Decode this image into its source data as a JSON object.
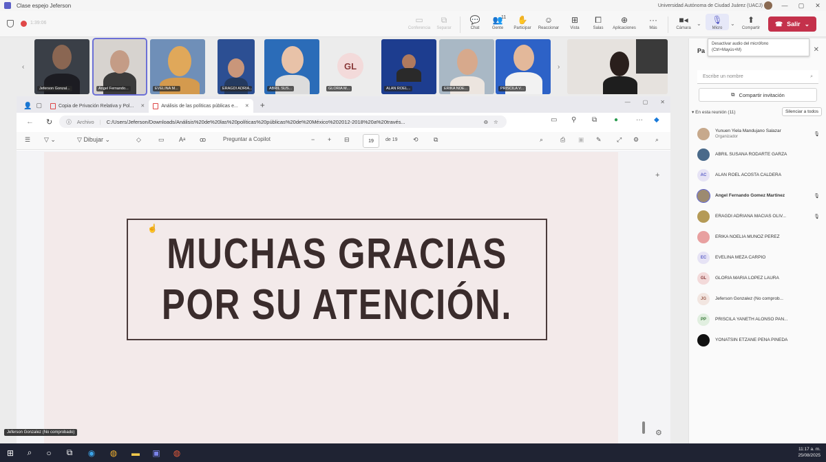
{
  "window": {
    "title": "Clase espejo Jeferson",
    "org": "Universidad Autónoma de Ciudad Juárez (UACJ)"
  },
  "meeting_toolbar": {
    "timer": "1:39:06",
    "buttons": [
      {
        "label": "Conferencia",
        "icon": "conference-icon"
      },
      {
        "label": "Separar",
        "icon": "pop-out-icon"
      },
      {
        "label": "Chat",
        "icon": "chat-icon"
      },
      {
        "label": "Gente",
        "icon": "people-icon",
        "count": "11"
      },
      {
        "label": "Participar",
        "icon": "raise-hand-icon"
      },
      {
        "label": "Reaccionar",
        "icon": "react-icon"
      },
      {
        "label": "Vista",
        "icon": "view-icon"
      },
      {
        "label": "Salas",
        "icon": "rooms-icon"
      },
      {
        "label": "Aplicaciones",
        "icon": "apps-icon"
      },
      {
        "label": "Más",
        "icon": "more-icon"
      },
      {
        "label": "Cámara",
        "icon": "camera-icon"
      },
      {
        "label": "Micro",
        "icon": "mic-icon"
      },
      {
        "label": "Compartir",
        "icon": "share-icon"
      }
    ],
    "leave_label": "Salir",
    "mic_tooltip_line1": "Desactivar audio del micrófono",
    "mic_tooltip_line2": "(Ctrl+Mayús+M)"
  },
  "video_tiles": [
    {
      "name": "Jeferson Gonzal..."
    },
    {
      "name": "Angel Fernando..."
    },
    {
      "name": "EVELINA M..."
    },
    {
      "name": "ERAGDI ADRIA..."
    },
    {
      "name": "ABRIL SUS..."
    },
    {
      "name": "GLORIA M...",
      "initials": "GL"
    },
    {
      "name": "ALAN ROEL..."
    },
    {
      "name": "ERIKA NOE..."
    },
    {
      "name": "PRISCILA V..."
    },
    {
      "name": ""
    }
  ],
  "browser": {
    "tabs": [
      {
        "label": "Copia de Privación Relativa y Pol..."
      },
      {
        "label": "Análisis de las políticas públicas e..."
      }
    ],
    "address_label": "Archivo",
    "url": "C:/Users/Jeferson/Downloads/Análisis%20de%20las%20políticas%20públicas%20de%20México%202012-2018%20a%20través...",
    "pdf_toolbar": {
      "draw_label": "Dibujar",
      "copilot_label": "Preguntar a Copilot",
      "page_current": "19",
      "page_total": "de 19"
    }
  },
  "slide": {
    "line1": "MUCHAS GRACIAS",
    "line2": "POR SU ATENCIÓN."
  },
  "participants_panel": {
    "title": "Pa",
    "search_placeholder": "Escribe un nombre",
    "invite_label": "Compartir invitación",
    "section_label": "▾ En esta reunión (11)",
    "mute_all_label": "Silenciar a todos",
    "participants": [
      {
        "name": "Yunuen Yiela Mandujano Salazar",
        "role": "Organizador",
        "initials": "",
        "avatar_color": "#c7a98c",
        "mic": true
      },
      {
        "name": "ABRIL SUSANA RODARTE GARZA",
        "role": "",
        "initials": "",
        "avatar_color": "#4a6a8a",
        "mic": false
      },
      {
        "name": "ALAN ROEL ACOSTA CALDERA",
        "role": "",
        "initials": "AC",
        "avatar_color": "#e6e3f5",
        "mic": false
      },
      {
        "name": "Angel Fernando Gomez Martinez",
        "role": "",
        "initials": "",
        "avatar_color": "#9c8a70",
        "mic": true
      },
      {
        "name": "ERAGDI ADRIANA MACIAS OLIV...",
        "role": "",
        "initials": "",
        "avatar_color": "#b59a56",
        "mic": true
      },
      {
        "name": "ERIKA NOELIA MUÑOZ PEREZ",
        "role": "",
        "initials": "",
        "avatar_color": "#e8a0a0",
        "mic": false
      },
      {
        "name": "EVELINA MEZA CARPIO",
        "role": "",
        "initials": "EC",
        "avatar_color": "#e6e3f5",
        "mic": false
      },
      {
        "name": "GLORIA MARIA LOPEZ LAURA",
        "role": "",
        "initials": "GL",
        "avatar_color": "#f3dada",
        "mic": false
      },
      {
        "name": "Jeferson Gonzalez (No comprob...",
        "role": "",
        "initials": "JG",
        "avatar_color": "#f2e6e1",
        "mic": false
      },
      {
        "name": "PRISCILA YANETH ALONSO PAN...",
        "role": "",
        "initials": "PP",
        "avatar_color": "#e1efe0",
        "mic": false
      },
      {
        "name": "YONATSIN ETZANE PEÑA PINEDA",
        "role": "",
        "initials": "",
        "avatar_color": "#111111",
        "mic": false
      }
    ]
  },
  "presenter_tag": "Jeferson Gonzalez (No comprobado)",
  "taskbar": {
    "time": "11:17 a. m.",
    "date": "25/08/2025"
  }
}
